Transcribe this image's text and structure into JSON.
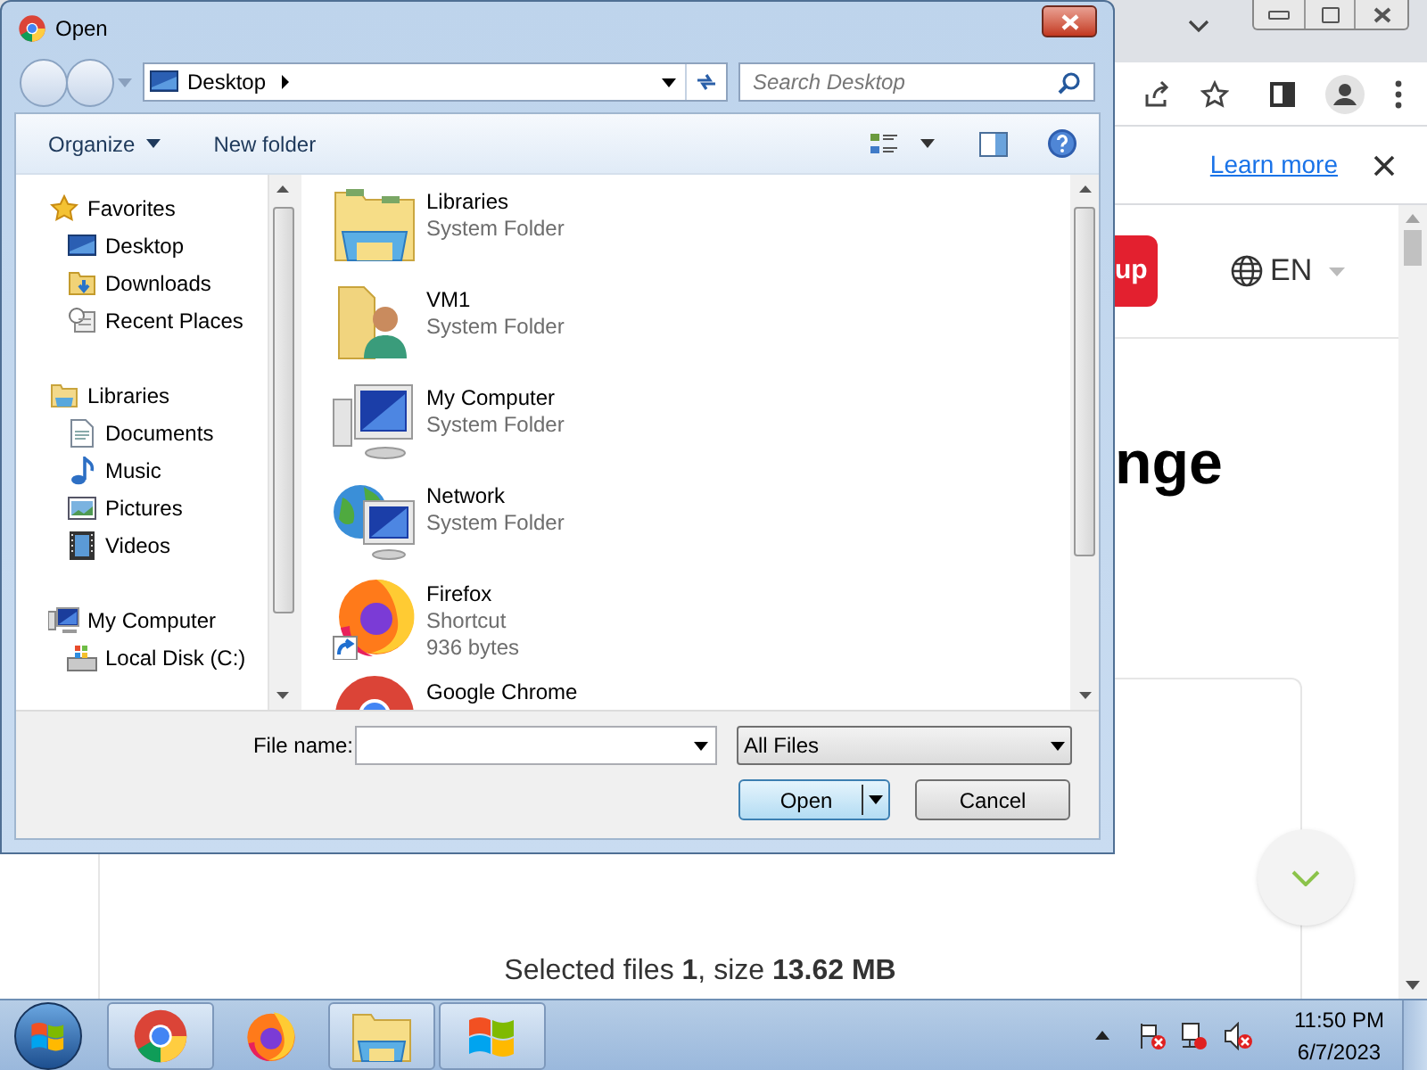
{
  "browser": {
    "infobar_link": "Learn more",
    "signup_button": "up",
    "language": "EN",
    "heading": "nge",
    "status": "Selected files **1**, size **13.62 MB**"
  },
  "dialog": {
    "title": "Open",
    "address": "Desktop",
    "search_placeholder": "Search Desktop",
    "toolbar": [
      {
        "label": "Organize",
        "kind": "menu"
      },
      {
        "label": "New folder",
        "kind": "button"
      }
    ],
    "nav": [
      {
        "label": "Favorites",
        "children": [
          {
            "label": "Desktop"
          },
          {
            "label": "Downloads"
          },
          {
            "label": "Recent Places"
          }
        ]
      },
      {
        "label": "Libraries",
        "children": [
          {
            "label": "Documents"
          },
          {
            "label": "Music"
          },
          {
            "label": "Pictures"
          },
          {
            "label": "Videos"
          }
        ]
      },
      {
        "label": "My Computer",
        "children": [
          {
            "label": "Local Disk (C:)"
          }
        ]
      }
    ],
    "files": [
      {
        "name": "Libraries",
        "details": [
          "System Folder"
        ]
      },
      {
        "name": "VM1",
        "details": [
          "System Folder"
        ]
      },
      {
        "name": "My Computer",
        "details": [
          "System Folder"
        ]
      },
      {
        "name": "Network",
        "details": [
          "System Folder"
        ]
      },
      {
        "name": "Firefox",
        "details": [
          "Shortcut",
          "936 bytes"
        ]
      },
      {
        "name": "Google Chrome"
      }
    ],
    "file_name_label": "File name:",
    "file_type": "All Files",
    "buttons": [
      {
        "label": "Open",
        "kind": "split",
        "default": true
      },
      {
        "label": "Cancel",
        "kind": "plain",
        "default": false
      }
    ]
  },
  "taskbar": {
    "apps": [
      {
        "running": true
      },
      {
        "running": false
      },
      {
        "running": true
      },
      {
        "running": true
      }
    ],
    "clock_time": "11:50 PM",
    "clock_date": "6/7/2023"
  }
}
